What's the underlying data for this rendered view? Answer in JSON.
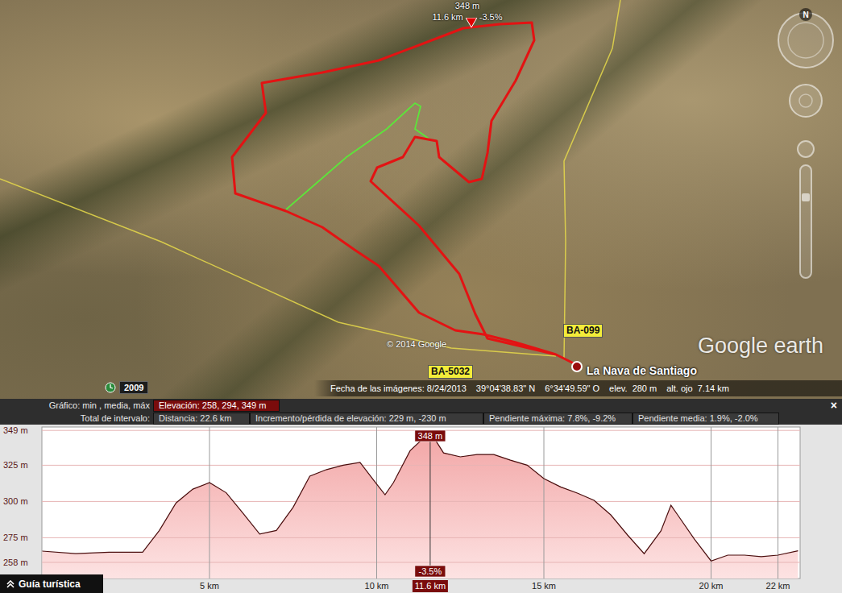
{
  "map": {
    "compass_label": "N",
    "history_year": "2009",
    "copyright": "© 2014 Google",
    "logo": "Google earth",
    "place_label": "La Nava de Santiago",
    "road_labels": [
      "BA-099",
      "BA-5032"
    ],
    "status_bar": [
      "Fecha de las imágenes: 8/24/2013",
      "39°04'38.83\" N",
      "6°34'49.59\" O",
      "elev.  280 m",
      "alt. ojo  7.14 km"
    ]
  },
  "profile": {
    "summary_label": "Gráfico: min , media, máx",
    "summary": "Elevación: 258, 294, 349 m",
    "interval_label": "Total de intervalo:",
    "interval_stats": [
      "Distancia: 22.6 km",
      "Incremento/pérdida de elevación: 229 m, -230 m",
      "Pendiente máxima: 7.8%, -9.2%",
      "Pendiente media: 1.9%, -2.0%"
    ],
    "close": "×",
    "y_ticks": [
      {
        "value": 349,
        "label": "349 m"
      },
      {
        "value": 325,
        "label": "325 m"
      },
      {
        "value": 300,
        "label": "300 m"
      },
      {
        "value": 275,
        "label": "275 m"
      },
      {
        "value": 258,
        "label": "258 m"
      }
    ],
    "x_ticks": [
      {
        "value": 5,
        "label": "5 km"
      },
      {
        "value": 10,
        "label": "10 km"
      },
      {
        "value": 15,
        "label": "15 km"
      },
      {
        "value": 20,
        "label": "20 km"
      },
      {
        "value": 22,
        "label": "22 km"
      }
    ],
    "series": {
      "distances_km": [
        0,
        1,
        2,
        3,
        3.5,
        4,
        4.5,
        5,
        5.5,
        6,
        6.5,
        7,
        7.5,
        8,
        8.5,
        9,
        9.5,
        10,
        10.25,
        10.5,
        11,
        11.6,
        12,
        12.5,
        13,
        13.5,
        14,
        14.5,
        15,
        15.5,
        16,
        16.5,
        17,
        17.5,
        18,
        18.5,
        18.8,
        19,
        19.5,
        20,
        20.5,
        21,
        21.5,
        22,
        22.6
      ],
      "elevations_m": [
        265.8,
        264,
        265,
        265,
        280,
        299,
        308.5,
        313,
        306,
        292,
        277.5,
        280,
        296,
        317.5,
        322,
        325,
        327,
        312,
        304.6,
        313,
        335,
        348,
        333.5,
        330.8,
        332.4,
        332.4,
        328.5,
        325,
        315.8,
        310,
        305.8,
        300.8,
        290.8,
        276.9,
        264,
        279.7,
        297.4,
        290.8,
        274,
        259,
        263,
        263,
        262,
        263,
        266
      ]
    },
    "cursor": {
      "km": 11.6,
      "elevation": 348,
      "elevation_label": "348 m",
      "distance_label": "11.6 km",
      "slope_label": "-3.5%"
    }
  },
  "tour_button": {
    "label": "Guía turística"
  }
}
